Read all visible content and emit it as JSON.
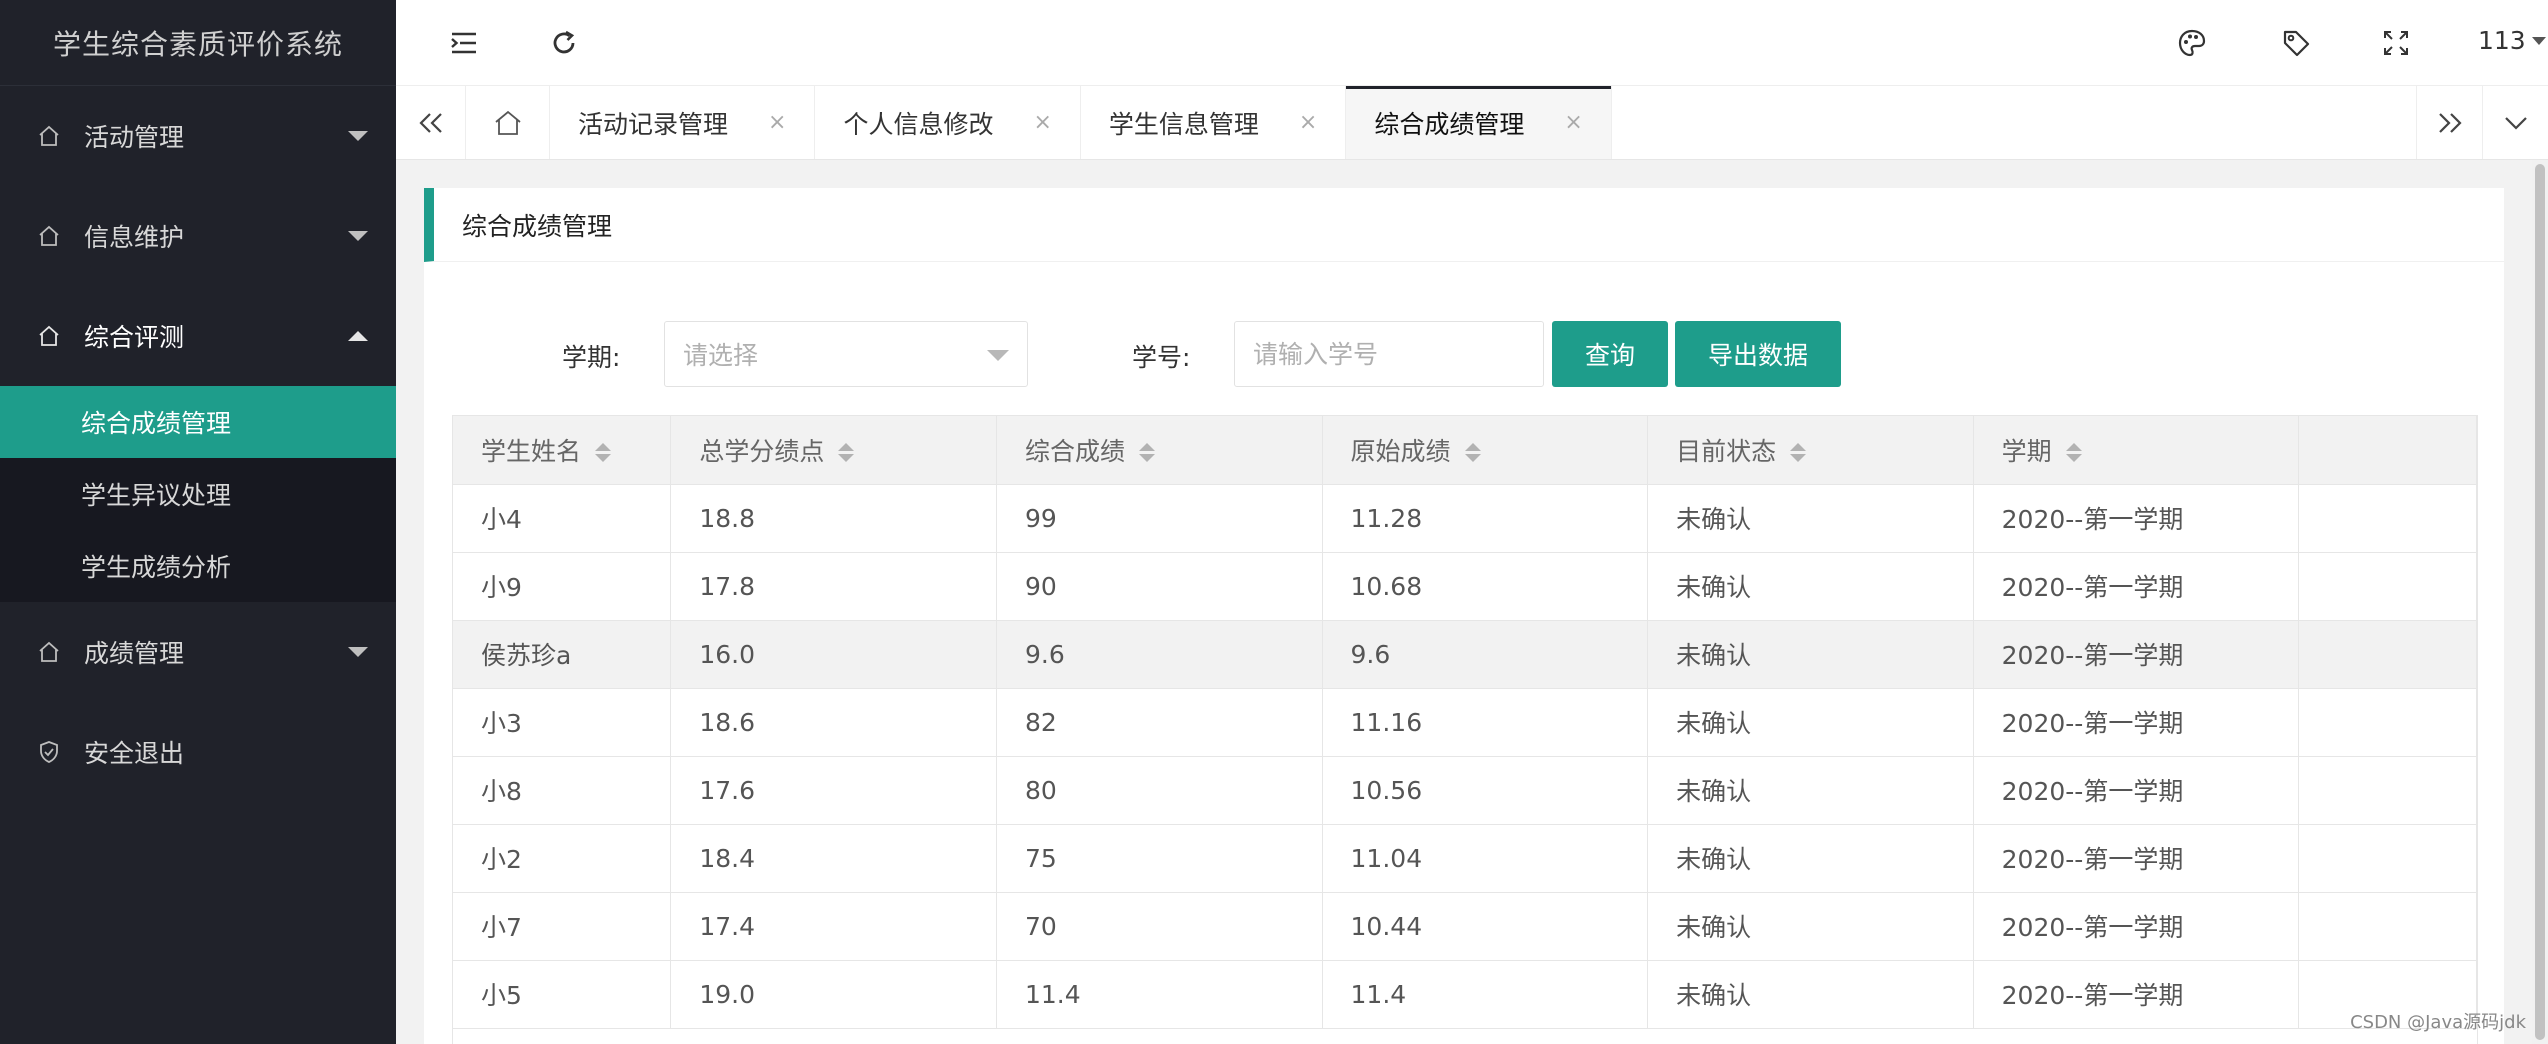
{
  "app": {
    "title": "学生综合素质评价系统"
  },
  "sidebar": {
    "groups": [
      {
        "label": "活动管理",
        "expanded": false
      },
      {
        "label": "信息维护",
        "expanded": false
      },
      {
        "label": "综合评测",
        "expanded": true
      },
      {
        "label": "成绩管理",
        "expanded": false
      },
      {
        "label": "安全退出"
      }
    ],
    "subitems": [
      "综合成绩管理",
      "学生异议处理",
      "学生成绩分析"
    ],
    "active_subitem": "综合成绩管理"
  },
  "header": {
    "user": "113"
  },
  "tabs": {
    "items": [
      {
        "label": "活动记录管理"
      },
      {
        "label": "个人信息修改"
      },
      {
        "label": "学生信息管理"
      },
      {
        "label": "综合成绩管理"
      }
    ],
    "active": "综合成绩管理",
    "close_glyph": "×"
  },
  "panel": {
    "title": "综合成绩管理",
    "filters": {
      "term_label": "学期:",
      "term_placeholder": "请选择",
      "id_label": "学号:",
      "id_placeholder": "请输入学号",
      "query_button": "查询",
      "export_button": "导出数据"
    },
    "table": {
      "columns": [
        "学生姓名",
        "总学分绩点",
        "综合成绩",
        "原始成绩",
        "目前状态",
        "学期"
      ],
      "rows": [
        [
          "小4",
          "18.8",
          "99",
          "11.28",
          "未确认",
          "2020--第一学期"
        ],
        [
          "小9",
          "17.8",
          "90",
          "10.68",
          "未确认",
          "2020--第一学期"
        ],
        [
          "侯苏珍a",
          "16.0",
          "9.6",
          "9.6",
          "未确认",
          "2020--第一学期"
        ],
        [
          "小3",
          "18.6",
          "82",
          "11.16",
          "未确认",
          "2020--第一学期"
        ],
        [
          "小8",
          "17.6",
          "80",
          "10.56",
          "未确认",
          "2020--第一学期"
        ],
        [
          "小2",
          "18.4",
          "75",
          "11.04",
          "未确认",
          "2020--第一学期"
        ],
        [
          "小7",
          "17.4",
          "70",
          "10.44",
          "未确认",
          "2020--第一学期"
        ],
        [
          "小5",
          "19.0",
          "11.4",
          "11.4",
          "未确认",
          "2020--第一学期"
        ]
      ],
      "highlighted_row": 2
    }
  },
  "footer": {
    "credit": "CSDN @Java源码jdk"
  },
  "colors": {
    "accent": "#1e9d8b",
    "sidebar_bg": "#20222a"
  }
}
